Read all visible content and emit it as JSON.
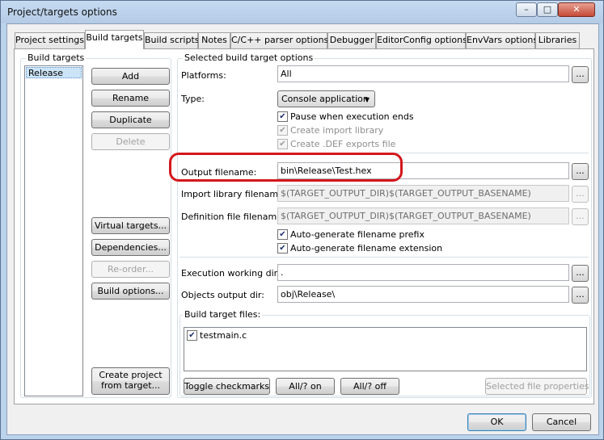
{
  "window": {
    "title": "Project/targets options"
  },
  "tabs": [
    {
      "label": "Project settings"
    },
    {
      "label": "Build targets"
    },
    {
      "label": "Build scripts"
    },
    {
      "label": "Notes"
    },
    {
      "label": "C/C++ parser options"
    },
    {
      "label": "Debugger"
    },
    {
      "label": "EditorConfig options"
    },
    {
      "label": "EnvVars options"
    },
    {
      "label": "Libraries"
    }
  ],
  "left": {
    "group_label": "Build targets",
    "targets": [
      "Release"
    ],
    "buttons": {
      "add": "Add",
      "rename": "Rename",
      "duplicate": "Duplicate",
      "delete": "Delete",
      "virtual_targets": "Virtual targets...",
      "dependencies": "Dependencies...",
      "reorder": "Re-order...",
      "build_options": "Build options...",
      "create_project_l1": "Create project",
      "create_project_l2": "from target..."
    }
  },
  "options": {
    "group_label": "Selected build target options",
    "platforms_label": "Platforms:",
    "platforms_value": "All",
    "type_label": "Type:",
    "type_value": "Console application",
    "pause_label": "Pause when execution ends",
    "pause_checked": true,
    "create_import_label": "Create import library",
    "create_def_label": "Create .DEF exports file",
    "output_label": "Output filename:",
    "output_value": "bin\\Release\\Test.hex",
    "import_label": "Import library filename:",
    "import_value": "$(TARGET_OUTPUT_DIR)$(TARGET_OUTPUT_BASENAME)",
    "def_label": "Definition file filename:",
    "def_value": "$(TARGET_OUTPUT_DIR)$(TARGET_OUTPUT_BASENAME)",
    "auto_prefix_label": "Auto-generate filename prefix",
    "auto_ext_label": "Auto-generate filename extension",
    "exec_dir_label": "Execution working dir:",
    "exec_dir_value": ".",
    "obj_dir_label": "Objects output dir:",
    "obj_dir_value": "obj\\Release\\",
    "ellipsis": "..."
  },
  "files": {
    "group_label": "Build target files:",
    "items": [
      {
        "name": "testmain.c",
        "checked": true
      }
    ],
    "toggle": "Toggle checkmarks",
    "all_on": "All/? on",
    "all_off": "All/? off",
    "selected_props": "Selected file properties"
  },
  "footer": {
    "ok": "OK",
    "cancel": "Cancel"
  },
  "colors": {
    "highlight": "#d4161b",
    "selection": "#cce4f7"
  }
}
